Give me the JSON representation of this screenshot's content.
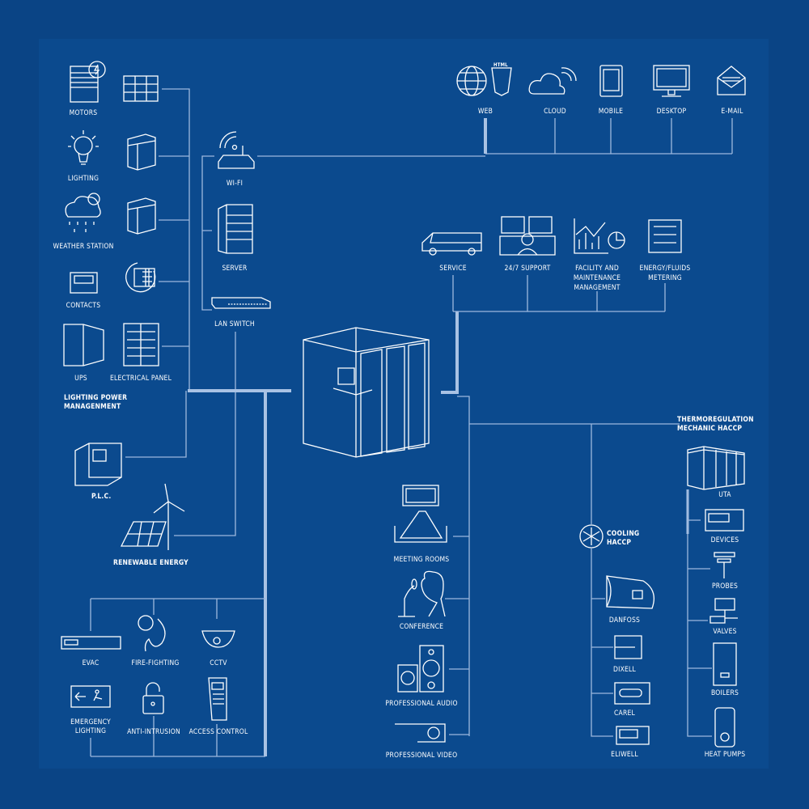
{
  "colors": {
    "background": "#0a4485",
    "panel": "#0b4a8e",
    "line": "#9db8dd",
    "icon": "#ffffff"
  },
  "left": {
    "motors": "MOTORS",
    "lighting": "LIGHTING",
    "weather": "WEATHER STATION",
    "contacts": "CONTACTS",
    "ups": "UPS",
    "electrical_panel": "ELECTRICAL PANEL",
    "group_line1": "LIGHTING POWER",
    "group_line2": "MANAGENMENT",
    "plc": "P.L.C.",
    "renewable": "RENEWABLE ENERGY"
  },
  "network": {
    "wifi": "WI-FI",
    "server": "SERVER",
    "lan_switch": "LAN SWITCH"
  },
  "top": {
    "web": "WEB",
    "html_badge": "HTML",
    "cloud": "CLOUD",
    "mobile": "MOBILE",
    "desktop": "DESKTOP",
    "email": "E-MAIL"
  },
  "services": {
    "service": "SERVICE",
    "support": "24/7 SUPPORT",
    "facility1": "FACILITY AND",
    "facility2": "MAINTENANCE",
    "facility3": "MANAGEMENT",
    "energy1": "ENERGY/FLUIDS",
    "energy2": "METERING"
  },
  "av": {
    "meeting": "MEETING ROOMS",
    "conference": "CONFERENCE",
    "audio": "PROFESSIONAL AUDIO",
    "video": "PROFESSIONAL VIDEO"
  },
  "cooling": {
    "title1": "COOLING",
    "title2": "HACCP",
    "danfoss": "DANFOSS",
    "dixell": "DIXELL",
    "carel": "CAREL",
    "eliwell": "ELIWELL"
  },
  "thermo": {
    "title1": "THERMOREGULATION",
    "title2": "MECHANIC HACCP",
    "uta": "UTA",
    "devices": "DEVICES",
    "probes": "PROBES",
    "valves": "VALVES",
    "boilers": "BOILERS",
    "heat_pumps": "HEAT PUMPS"
  },
  "security": {
    "evac": "EVAC",
    "fire": "FIRE-FIGHTING",
    "cctv": "CCTV",
    "emergency1": "EMERGENCY",
    "emergency2": "LIGHTING",
    "anti_intrusion": "ANTI-INTRUSION",
    "access": "ACCESS CONTROL"
  }
}
